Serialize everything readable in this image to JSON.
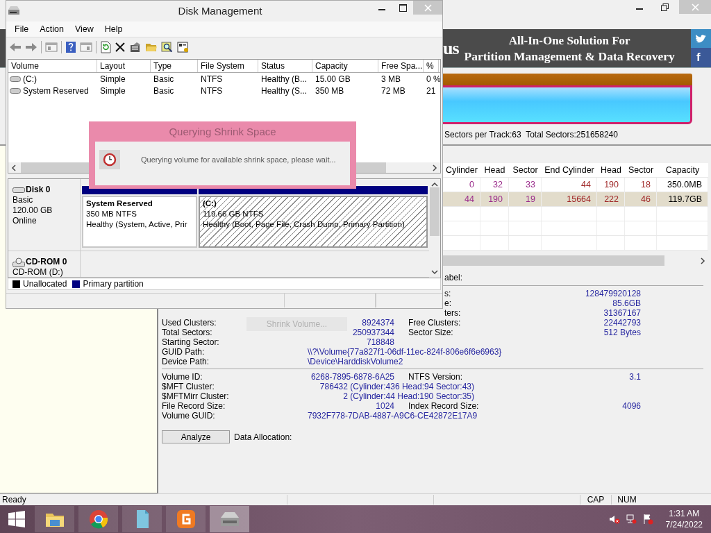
{
  "partition_tool": {
    "banner": {
      "logo_fragment": "us",
      "line1": "All-In-One Solution For",
      "line2": "Partition Management & Data Recovery",
      "social_icons": [
        {
          "kind": "bird"
        },
        {
          "kind": "letter",
          "text": "f"
        }
      ]
    },
    "disk_info": "Sectors per Track:63  Total Sectors:251658240",
    "table": {
      "columns": [
        "Cylinder",
        "Head",
        "Sector",
        "End Cylinder",
        "Head",
        "Sector",
        "Capacity"
      ],
      "rows": [
        {
          "cells": [
            "0",
            "32",
            "33",
            "44",
            "190",
            "18",
            "350.0MB"
          ],
          "selected": false
        },
        {
          "cells": [
            "44",
            "190",
            "19",
            "15664",
            "222",
            "46",
            "119.7GB"
          ],
          "selected": true
        }
      ]
    },
    "label_fragment": "abel:",
    "summary": [
      {
        "label": "s:",
        "value": "128479920128"
      },
      {
        "label": "e:",
        "value": "85.6GB"
      },
      {
        "label": "ters:",
        "value": "31367167"
      }
    ],
    "details": [
      {
        "kind": "pair",
        "label": "Used Clusters:",
        "value": "8924374",
        "label2": "Free Clusters:",
        "value2": "22442793"
      },
      {
        "kind": "pair",
        "label": "Total Sectors:",
        "value": "250937344",
        "label2": "Sector Size:",
        "value2": "512 Bytes"
      },
      {
        "kind": "pair",
        "label": "Starting Sector:",
        "value": "718848"
      },
      {
        "kind": "wide",
        "label": "GUID Path:",
        "value": "\\\\?\\Volume{77a827f1-06df-11ec-824f-806e6f6e6963}"
      },
      {
        "kind": "wide",
        "label": "Device Path:",
        "value": "\\Device\\HarddiskVolume2"
      }
    ],
    "details2": [
      {
        "kind": "pair",
        "label": "Volume ID:",
        "value": "6268-7895-6878-6A25",
        "label2": "NTFS Version:",
        "value2": "3.1"
      },
      {
        "kind": "span",
        "label": "$MFT Cluster:",
        "value": "786432 (Cylinder:436 Head:94 Sector:43)"
      },
      {
        "kind": "span",
        "label": "$MFTMirr Cluster:",
        "value": "2 (Cylinder:44 Head:190 Sector:35)"
      },
      {
        "kind": "pair",
        "label": "File Record Size:",
        "value": "1024",
        "label2": "Index Record Size:",
        "value2": "4096"
      },
      {
        "kind": "wide",
        "label": "Volume GUID:",
        "value": "7932F778-7DAB-4887-A9C6-CE42872E17A9"
      }
    ],
    "ghost_button": {
      "label": "Shrink Volume...",
      "disabled": true
    },
    "analyze_button": "Analyze",
    "data_allocation_label": "Data Allocation:",
    "status_bar": {
      "text": "Ready",
      "indicators": [
        "CAP",
        "NUM"
      ]
    }
  },
  "disk_management": {
    "title": "Disk Management",
    "menu": [
      "File",
      "Action",
      "View",
      "Help"
    ],
    "volume_table": {
      "columns": [
        "Volume",
        "Layout",
        "Type",
        "File System",
        "Status",
        "Capacity",
        "Free Spa...",
        "%"
      ],
      "rows": [
        {
          "cells": [
            "(C:)",
            "Simple",
            "Basic",
            "NTFS",
            "Healthy (B...",
            "15.00 GB",
            "3 MB",
            "0 %"
          ]
        },
        {
          "cells": [
            "System Reserved",
            "Simple",
            "Basic",
            "NTFS",
            "Healthy (S...",
            "350 MB",
            "72 MB",
            "21"
          ]
        }
      ]
    },
    "disks": [
      {
        "kind": "disk",
        "name": "Disk 0",
        "lines": [
          "Basic",
          "120.00 GB",
          "Online"
        ],
        "partitions": [
          {
            "name": "System Reserved",
            "size": "350 MB NTFS",
            "status": "Healthy (System, Active, Prir",
            "selected": false
          },
          {
            "name": "(C:)",
            "size": "119.66 GB NTFS",
            "status": "Healthy (Boot, Page File, Crash Dump, Primary Partition)",
            "selected": true
          }
        ]
      },
      {
        "kind": "cdrom",
        "name": "CD-ROM 0",
        "lines": [
          "CD-ROM (D:)"
        ]
      }
    ],
    "legend": [
      {
        "label": "Unallocated",
        "color": "#000000"
      },
      {
        "label": "Primary partition",
        "color": "#000080"
      }
    ]
  },
  "dialog": {
    "title": "Querying Shrink Space",
    "message": "Querying volume for available shrink space, please wait..."
  },
  "taskbar": {
    "apps": [
      {
        "kind": "explorer",
        "selected": false
      },
      {
        "kind": "browser",
        "selected": false
      },
      {
        "kind": "document",
        "selected": false
      },
      {
        "kind": "partition",
        "selected": false
      },
      {
        "kind": "disk",
        "selected": true
      }
    ],
    "time": "1:31 AM",
    "date": "7/24/2022"
  }
}
